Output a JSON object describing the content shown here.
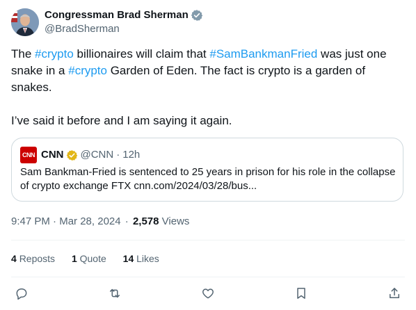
{
  "author": {
    "display_name": "Congressman Brad Sherman",
    "handle": "@BradSherman",
    "verified_color": "#829aab"
  },
  "tweet": {
    "p1_a": "The ",
    "p1_tag1": "#crypto",
    "p1_b": " billionaires will claim that ",
    "p1_tag2": "#SamBankmanFried",
    "p1_c": " was just one snake in a ",
    "p1_tag3": "#crypto",
    "p1_d": " Garden of Eden. The fact is crypto is a garden of snakes.",
    "p2": "I’ve said it before and I am saying it again."
  },
  "quote": {
    "logo_text": "CNN",
    "name": "CNN",
    "handle": "@CNN",
    "separator": "·",
    "age": "12h",
    "text": "Sam Bankman-Fried is sentenced to 25 years in prison for his role in the collapse of crypto exchange FTX cnn.com/2024/03/28/bus..."
  },
  "meta": {
    "time": "9:47 PM",
    "dot1": "·",
    "date": "Mar 28, 2024",
    "dot2": "·",
    "views_count": "2,578",
    "views_label": "Views"
  },
  "stats": {
    "reposts_count": "4",
    "reposts_label": "Reposts",
    "quotes_count": "1",
    "quotes_label": "Quote",
    "likes_count": "14",
    "likes_label": "Likes"
  },
  "actions": [
    "reply-icon",
    "repost-icon",
    "like-icon",
    "bookmark-icon",
    "share-icon"
  ],
  "colors": {
    "link": "#1d9bf0",
    "secondary_text": "#536471",
    "cnn_red": "#cc0000",
    "gold_badge": "#e2b719"
  }
}
